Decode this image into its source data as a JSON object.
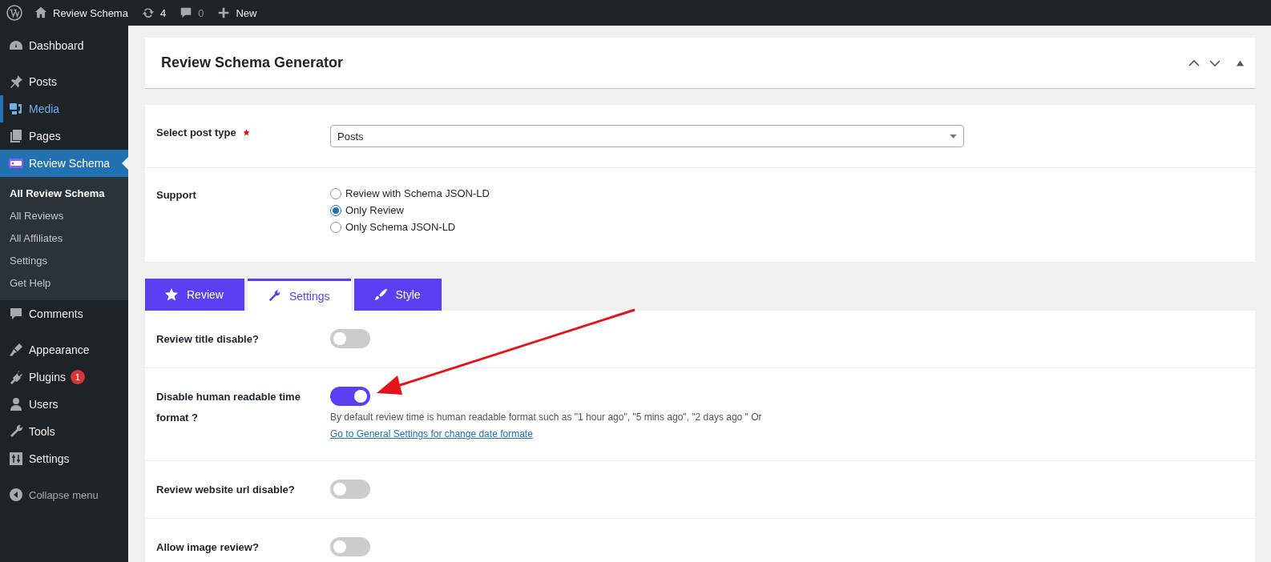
{
  "admin_bar": {
    "site": "Review Schema",
    "updates": "4",
    "comments": "0",
    "new": "New"
  },
  "sidebar": {
    "groups": [
      [
        {
          "label": "Dashboard",
          "selected": false,
          "hovered": false
        }
      ],
      [
        {
          "label": "Posts",
          "selected": false,
          "hovered": false
        },
        {
          "label": "Media",
          "selected": false,
          "hovered": true
        },
        {
          "label": "Pages",
          "selected": false,
          "hovered": false
        },
        {
          "label": "Review Schema",
          "selected": true,
          "hovered": false,
          "children": [
            {
              "label": "All Review Schema",
              "selected": true
            },
            {
              "label": "All Reviews",
              "selected": false
            },
            {
              "label": "All Affiliates",
              "selected": false
            },
            {
              "label": "Settings",
              "selected": false
            },
            {
              "label": "Get Help",
              "selected": false
            }
          ]
        },
        {
          "label": "Comments",
          "selected": false,
          "hovered": false
        }
      ],
      [
        {
          "label": "Appearance",
          "selected": false,
          "hovered": false
        },
        {
          "label": "Plugins",
          "selected": false,
          "hovered": false,
          "badge": "1"
        },
        {
          "label": "Users",
          "selected": false,
          "hovered": false
        },
        {
          "label": "Tools",
          "selected": false,
          "hovered": false
        },
        {
          "label": "Settings",
          "selected": false,
          "hovered": false
        }
      ]
    ],
    "collapse": "Collapse menu"
  },
  "panel": {
    "title": "Review Schema Generator"
  },
  "form": {
    "post_type": {
      "label": "Select post type",
      "required": true,
      "value": "Posts"
    },
    "support": {
      "label": "Support",
      "options": [
        {
          "label": "Review with Schema JSON-LD",
          "selected": false
        },
        {
          "label": "Only Review",
          "selected": true
        },
        {
          "label": "Only Schema JSON-LD",
          "selected": false
        }
      ]
    }
  },
  "tabs": [
    {
      "label": "Review",
      "selected": false
    },
    {
      "label": "Settings",
      "selected": true
    },
    {
      "label": "Style",
      "selected": false
    }
  ],
  "settings": [
    {
      "label": "Review title disable?",
      "on": false
    },
    {
      "label": "Disable human readable time format ?",
      "on": true,
      "description": "By default review time is human readable format such as \"1 hour ago\", \"5 mins ago\", \"2 days ago \" Or",
      "link": "Go to General Settings for change date formate"
    },
    {
      "label": "Review website url disable?",
      "on": false
    },
    {
      "label": "Allow image review?",
      "on": false
    }
  ]
}
